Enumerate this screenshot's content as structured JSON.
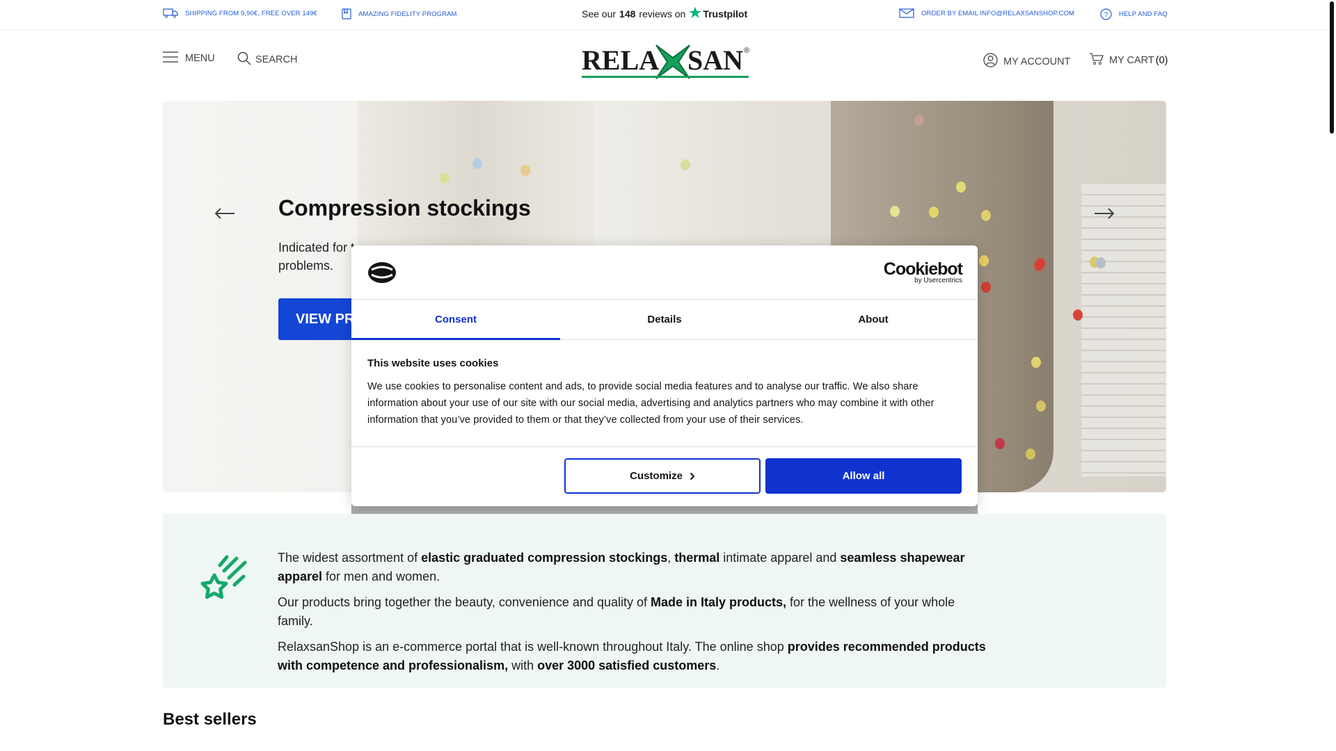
{
  "topbar": {
    "shipping": "SHIPPING FROM 9,90€, FREE OVER 149€",
    "fidelity": "AMAZING FIDELITY PROGRAM",
    "trustpilot_prefix": "See our",
    "trustpilot_count": "148",
    "trustpilot_mid": "reviews on",
    "trustpilot_brand": "Trustpilot",
    "email": "ORDER BY EMAIL INFO@RELAXSANSHOP.COM",
    "help": "HELP AND FAQ"
  },
  "header": {
    "menu": "MENU",
    "search": "SEARCH",
    "logo_left": "RELA",
    "logo_right": "SAN",
    "logo_reg": "®",
    "account": "MY ACCOUNT",
    "cart_label": "MY CART",
    "cart_count": "(0)"
  },
  "hero": {
    "title": "Compression stockings",
    "subtitle_visible_1": "Indicated for t",
    "subtitle_visible_2": "problems.",
    "button_visible": "VIEW PR"
  },
  "cookie": {
    "brand": "Cookiebot",
    "brand_sub": "by Usercentrics",
    "tabs": [
      "Consent",
      "Details",
      "About"
    ],
    "active_tab": "Consent",
    "heading": "This website uses cookies",
    "text": "We use cookies to personalise content and ads, to provide social media features and to analyse our traffic. We also share information about your use of our site with our social media, advertising and analytics partners who may combine it with other information that you’ve provided to them or that they’ve collected from your use of their services.",
    "customize": "Customize",
    "allow_all": "Allow all",
    "accent_color": "#1032cf"
  },
  "info": {
    "p1": [
      {
        "t": "The widest assortment of ",
        "b": false
      },
      {
        "t": "elastic graduated compression stockings",
        "b": true
      },
      {
        "t": ", ",
        "b": false
      },
      {
        "t": "thermal",
        "b": true
      },
      {
        "t": " intimate apparel and ",
        "b": false
      },
      {
        "t": "seamless shapewear apparel",
        "b": true
      },
      {
        "t": " for men and women.",
        "b": false
      }
    ],
    "p2": [
      {
        "t": "Our products bring together the beauty, convenience and quality of ",
        "b": false
      },
      {
        "t": "Made in Italy products,",
        "b": true
      },
      {
        "t": " for the wellness of your whole family.",
        "b": false
      }
    ],
    "p3": [
      {
        "t": "RelaxsanShop is an e-commerce portal that is well-known throughout Italy. The online shop ",
        "b": false
      },
      {
        "t": "provides recommended products with competence and professionalism,",
        "b": true
      },
      {
        "t": " with ",
        "b": false
      },
      {
        "t": "over 3000 satisfied customers",
        "b": true
      },
      {
        "t": ".",
        "b": false
      }
    ],
    "accent_color": "#15a86b"
  },
  "best_sellers": "Best sellers",
  "icons": [
    "truck-icon",
    "card-icon",
    "star-icon",
    "mail-icon",
    "help-icon",
    "menu-icon",
    "search-icon",
    "user-icon",
    "cart-icon",
    "arrow-left-icon",
    "arrow-right-icon",
    "cookie-logo-icon",
    "chevron-right-icon",
    "shooting-star-icon"
  ]
}
